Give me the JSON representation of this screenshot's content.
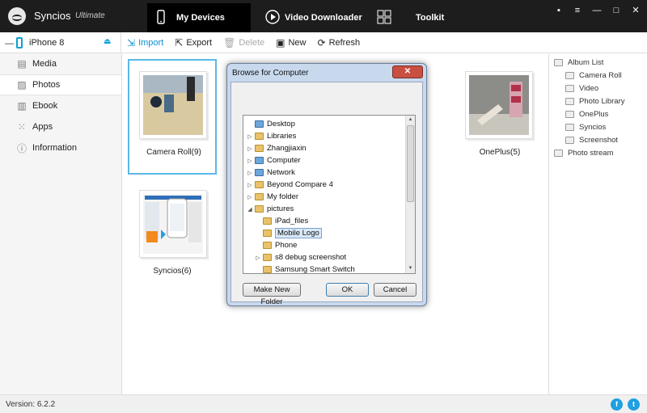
{
  "app": {
    "name": "Syncios",
    "edition": "Ultimate"
  },
  "nav": {
    "devices": "My Devices",
    "video": "Video Downloader",
    "toolkit": "Toolkit"
  },
  "window_controls": [
    "▪",
    "≡",
    "—",
    "□",
    "✕"
  ],
  "device": {
    "name": "iPhone 8"
  },
  "toolbar": {
    "import": "Import",
    "export": "Export",
    "delete": "Delete",
    "new": "New",
    "refresh": "Refresh"
  },
  "sidebar": {
    "items": [
      {
        "label": "Media",
        "icon": "media-icon"
      },
      {
        "label": "Photos",
        "icon": "photos-icon"
      },
      {
        "label": "Ebook",
        "icon": "ebook-icon"
      },
      {
        "label": "Apps",
        "icon": "apps-icon"
      },
      {
        "label": "Information",
        "icon": "info-icon"
      }
    ]
  },
  "albums": [
    {
      "label": "Camera Roll(9)"
    },
    {
      "label": "OnePlus(5)"
    },
    {
      "label": "Syncios(6)"
    }
  ],
  "album_list": {
    "root": "Album List",
    "children": [
      "Camera Roll",
      "Video",
      "Photo Library",
      "OnePlus",
      "Syncios",
      "Screenshot"
    ],
    "stream": "Photo stream"
  },
  "status": {
    "version": "Version: 6.2.2"
  },
  "dialog": {
    "title": "Browse for Computer",
    "close": "✕",
    "tree": [
      {
        "label": "Desktop"
      },
      {
        "label": "Libraries"
      },
      {
        "label": "Zhangjiaxin"
      },
      {
        "label": "Computer"
      },
      {
        "label": "Network"
      },
      {
        "label": "Beyond Compare 4"
      },
      {
        "label": "My folder"
      },
      {
        "label": "pictures"
      },
      {
        "label": "iPad_files"
      },
      {
        "label": "Mobile Logo"
      },
      {
        "label": "Phone"
      },
      {
        "label": "s8 debug screenshot"
      },
      {
        "label": "Samsung Smart Switch"
      }
    ],
    "new_folder": "Make New Folder",
    "ok": "OK",
    "cancel": "Cancel"
  },
  "colors": {
    "accent": "#0a8fd0",
    "titlebar": "#1d1d1d",
    "selection": "#5ab9e8"
  }
}
